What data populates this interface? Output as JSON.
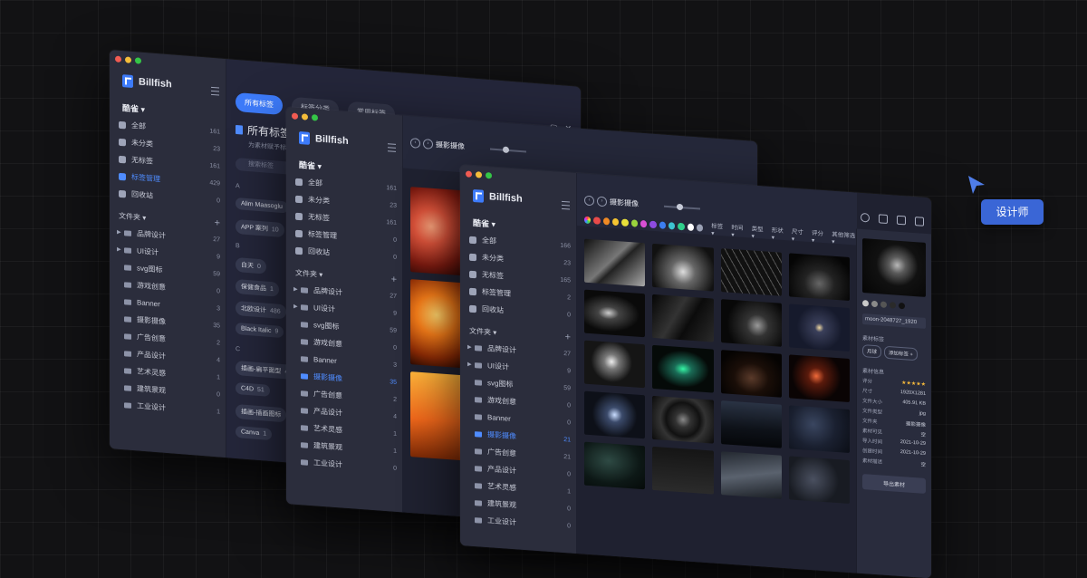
{
  "window1": {
    "brand": "Billfish",
    "library": "酷雀 ▾",
    "nav": [
      {
        "label": "全部",
        "count": "161"
      },
      {
        "label": "未分类",
        "count": "23"
      },
      {
        "label": "无标签",
        "count": "161"
      },
      {
        "label": "标签管理",
        "count": "429"
      },
      {
        "label": "回收站",
        "count": "0"
      }
    ],
    "folders_label": "文件夹 ▾",
    "folders": [
      {
        "label": "品牌设计",
        "count": "27"
      },
      {
        "label": "UI设计",
        "count": "9"
      },
      {
        "label": "svg图标",
        "count": "59"
      },
      {
        "label": "游戏创意",
        "count": "0"
      },
      {
        "label": "Banner",
        "count": "3"
      },
      {
        "label": "摄影摄像",
        "count": "35"
      },
      {
        "label": "广告创意",
        "count": "2"
      },
      {
        "label": "产品设计",
        "count": "4"
      },
      {
        "label": "艺术灵感",
        "count": "1"
      },
      {
        "label": "建筑景观",
        "count": "0"
      },
      {
        "label": "工业设计",
        "count": "1"
      }
    ],
    "tabs": [
      "所有标签",
      "标签分类",
      "常用标签"
    ],
    "page_title": "所有标签",
    "page_title_count": "(4",
    "page_sub": "为素材赋予标签",
    "search_placeholder": "搜索标签",
    "sections": {
      "a": "A",
      "b": "B",
      "c": "C"
    },
    "tags_a": [
      {
        "name": "Alim Maasoglu",
        "n": ""
      },
      {
        "name": "APP 案列",
        "n": "10"
      }
    ],
    "tags_b": [
      {
        "name": "白天",
        "n": "0"
      },
      {
        "name": "保健食品",
        "n": "1"
      },
      {
        "name": "北欧设计",
        "n": "486"
      },
      {
        "name": "Black Italic",
        "n": "9"
      }
    ],
    "tags_c": [
      {
        "name": "插画-扁平面型",
        "n": "4"
      },
      {
        "name": "C4D",
        "n": "51"
      },
      {
        "name": "插画-插画图标",
        "n": ""
      },
      {
        "name": "Canva",
        "n": "1"
      }
    ],
    "window_controls": [
      "—",
      "▢",
      "✕"
    ]
  },
  "window2": {
    "brand": "Billfish",
    "library": "酷雀 ▾",
    "nav": [
      {
        "label": "全部",
        "count": "161"
      },
      {
        "label": "未分类",
        "count": "23"
      },
      {
        "label": "无标签",
        "count": "161"
      },
      {
        "label": "标签管理",
        "count": "0"
      },
      {
        "label": "回收站",
        "count": "0"
      }
    ],
    "folders_label": "文件夹 ▾",
    "folders": [
      {
        "label": "品牌设计",
        "count": "27"
      },
      {
        "label": "UI设计",
        "count": "9"
      },
      {
        "label": "svg图标",
        "count": "59"
      },
      {
        "label": "游戏创意",
        "count": "0"
      },
      {
        "label": "Banner",
        "count": "3"
      },
      {
        "label": "摄影摄像",
        "count": "35"
      },
      {
        "label": "广告创意",
        "count": "2"
      },
      {
        "label": "产品设计",
        "count": "4"
      },
      {
        "label": "艺术灵感",
        "count": "1"
      },
      {
        "label": "建筑景观",
        "count": "1"
      },
      {
        "label": "工业设计",
        "count": "0"
      }
    ],
    "folder_title": "摄影摄像"
  },
  "window3": {
    "brand": "Billfish",
    "library": "酷雀 ▾",
    "nav": [
      {
        "label": "全部",
        "count": "166"
      },
      {
        "label": "未分类",
        "count": "23"
      },
      {
        "label": "无标签",
        "count": "165"
      },
      {
        "label": "标签管理",
        "count": "2"
      },
      {
        "label": "回收站",
        "count": "0"
      }
    ],
    "folders_label": "文件夹 ▾",
    "folders": [
      {
        "label": "品牌设计",
        "count": "27"
      },
      {
        "label": "UI设计",
        "count": "9"
      },
      {
        "label": "svg图标",
        "count": "59"
      },
      {
        "label": "游戏创意",
        "count": "0"
      },
      {
        "label": "Banner",
        "count": "0"
      },
      {
        "label": "摄影摄像",
        "count": "21"
      },
      {
        "label": "广告创意",
        "count": "21"
      },
      {
        "label": "产品设计",
        "count": "0"
      },
      {
        "label": "艺术灵感",
        "count": "1"
      },
      {
        "label": "建筑景观",
        "count": "0"
      },
      {
        "label": "工业设计",
        "count": "0"
      }
    ],
    "folder_title": "摄影摄像",
    "filters": [
      "标签 ▾",
      "时间 ▾",
      "类型 ▾",
      "形状 ▾",
      "尺寸 ▾",
      "评分 ▾",
      "其他筛选 ▾"
    ],
    "swatch_colors": [
      "#e84a4a",
      "#f08a24",
      "#f5c431",
      "#e8e03a",
      "#9bd43d",
      "#d94fd4",
      "#8e4be0",
      "#3c7ef0",
      "#3dc3d0",
      "#2fcf8a",
      "#ffffff",
      "#9aa0b4"
    ],
    "inspector": {
      "filename": "moon-2048727_1920",
      "tag_section": "素材标签",
      "tags": [
        "月球",
        "添加标签 +"
      ],
      "info_section": "素材信息",
      "rows": [
        {
          "k": "评分",
          "v": "★★★★★"
        },
        {
          "k": "尺寸",
          "v": "1920X1281"
        },
        {
          "k": "文件大小",
          "v": "405.91 KB"
        },
        {
          "k": "文件类型",
          "v": "jpg"
        },
        {
          "k": "文件夹",
          "v": "摄影摄像"
        },
        {
          "k": "素材可见",
          "v": "空"
        },
        {
          "k": "导入时间",
          "v": "2021-10-29"
        },
        {
          "k": "创建时间",
          "v": "2021-10-29"
        },
        {
          "k": "素材描述",
          "v": "空"
        }
      ],
      "export_label": "导出素材"
    }
  },
  "tooltip": {
    "label": "设计师",
    "accent": "#3a66d6"
  }
}
